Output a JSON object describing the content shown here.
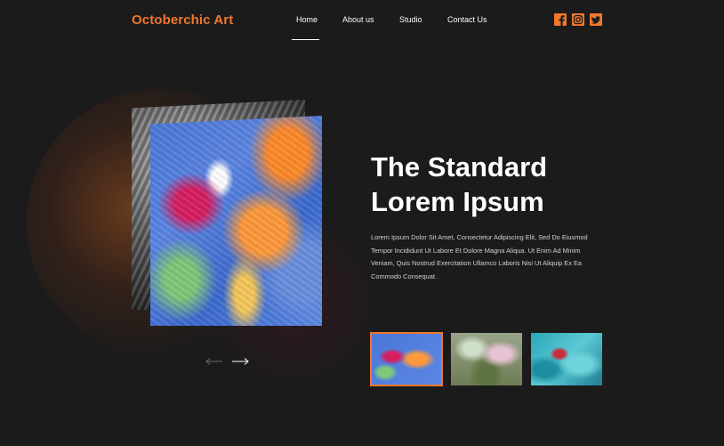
{
  "brand": {
    "name": "Octoberchic Art",
    "accent_color": "#f0772c"
  },
  "nav": {
    "items": [
      {
        "label": "Home",
        "active": true
      },
      {
        "label": "About us",
        "active": false
      },
      {
        "label": "Studio",
        "active": false
      },
      {
        "label": "Contact Us",
        "active": false
      }
    ]
  },
  "social": [
    {
      "icon": "facebook-icon"
    },
    {
      "icon": "instagram-icon"
    },
    {
      "icon": "twitter-icon"
    }
  ],
  "hero": {
    "title_line1": "The Standard",
    "title_line2": "Lorem Ipsum",
    "description": "Lorem Ipsum Dolor Sit Amet, Consectetur Adipiscing Elit, Sed Do Eiusmod Tempor Incididunt Ut Labore Et Dolore Magna Aliqua. Ut Enim Ad Minim Veniam, Quis Nostrud Exercitation Ullamco Laboris Nisi Ut Aliquip Ex Ea Commodo Consequat."
  },
  "carousel": {
    "prev_icon": "arrow-left-icon",
    "next_icon": "arrow-right-icon",
    "thumbnails": [
      {
        "name": "abstract-colorful-painting",
        "active": true
      },
      {
        "name": "blossom-tree-painting",
        "active": false
      },
      {
        "name": "teal-abstract-painting",
        "active": false
      }
    ]
  }
}
